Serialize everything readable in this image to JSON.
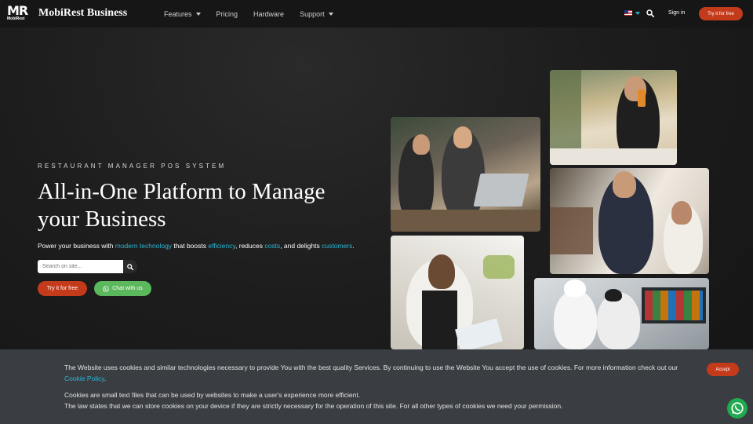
{
  "nav": {
    "logo_mark": "MR",
    "logo_sub": "MobiRest",
    "brand": "MobiRest Business",
    "items": [
      {
        "label": "Features",
        "has_caret": true
      },
      {
        "label": "Pricing",
        "has_caret": false
      },
      {
        "label": "Hardware",
        "has_caret": false
      },
      {
        "label": "Support",
        "has_caret": true
      }
    ],
    "signin": "Sign in",
    "try_label": "Try it for free"
  },
  "hero": {
    "eyebrow": "RESTAURANT MANAGER POS SYSTEM",
    "headline": "All-in-One Platform to Manage your Business",
    "sub": {
      "t1": "Power your business with ",
      "h1": "modern technology",
      "t2": " that boosts ",
      "h2": "efficiency",
      "t3": ", reduces ",
      "h3": "costs",
      "t4": ", and delights ",
      "h4": "customers",
      "t5": "."
    },
    "search_placeholder": "Search on site...",
    "try_label": "Try it for free",
    "chat_label": "Chat with us"
  },
  "cookie": {
    "line1": "The Website uses cookies and similar technologies necessary to provide You with the best quality Services. By continuing to use the Website You accept the use of cookies. For more information check out our ",
    "policy_link": "Cookie Policy",
    "line1_end": ".",
    "line2": "Cookies are small text files that can be used by websites to make a user's experience more efficient.",
    "line3": "The law states that we can store cookies on your device if they are strictly necessary for the operation of this site. For all other types of cookies we need your permission.",
    "accept_label": "Accept"
  },
  "colors": {
    "accent": "#c43b1c",
    "highlight": "#29b6d6",
    "chat_green": "#5cb85c",
    "whatsapp": "#1faa4f"
  },
  "icons": [
    "search-icon",
    "chevron-down-icon",
    "us-flag-icon",
    "whatsapp-icon"
  ]
}
